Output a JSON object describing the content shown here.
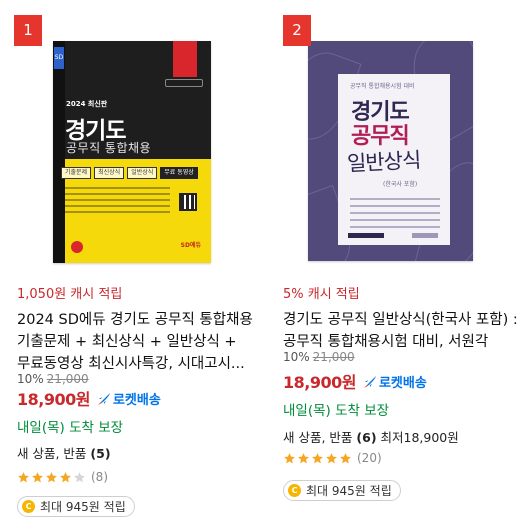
{
  "products": [
    {
      "rank": "1",
      "cover": {
        "year": "2024 최신판",
        "title": "경기도",
        "subtitle": "공무직 통합채용",
        "tags": [
          "기출문제",
          "최신상식",
          "일반상식",
          "무료 동영상"
        ],
        "publisher": "SD에듀"
      },
      "cashback": "1,050원 캐시 적립",
      "title": "2024 SD에듀 경기도 공무직 통합채용 기출문제 + 최신상식 + 일반상식 + 무료동영상 최신시사특강, 시대고시...",
      "discount": "10%",
      "original_price": "21,000",
      "price": "18,900원",
      "rocket_label": "로켓배송",
      "delivery": "내일(목) 도착 보장",
      "condition_prefix": "새 상품, 반품",
      "condition_count": "(5)",
      "condition_suffix": "",
      "rating": 4,
      "review_count": "(8)",
      "reward": "최대 945원 적립"
    },
    {
      "rank": "2",
      "cover": {
        "top_text": "공무직 통합채용시험 대비",
        "title_line1": "경기도",
        "title_line2": "공무직",
        "title_line3": "일반상식",
        "tag": "(한국사 포함)"
      },
      "cashback": "5% 캐시 적립",
      "title": "경기도 공무직 일반상식(한국사 포함) : 공무직 통합채용시험 대비, 서원각",
      "discount": "10%",
      "original_price": "21,000",
      "price": "18,900원",
      "rocket_label": "로켓배송",
      "delivery": "내일(목) 도착 보장",
      "condition_prefix": "새 상품, 반품",
      "condition_count": "(6)",
      "condition_suffix": " 최저18,900원",
      "rating": 5,
      "review_count": "(20)",
      "reward": "최대 945원 적립"
    }
  ],
  "colors": {
    "accent_red": "#c8292c",
    "rocket_blue": "#0073e9",
    "delivery_green": "#008c3a",
    "star_orange": "#f5a623",
    "rank_badge": "#e5352c"
  },
  "icons": {
    "rocket": "rocket-icon",
    "coin": "coin-icon",
    "star": "star-icon"
  }
}
